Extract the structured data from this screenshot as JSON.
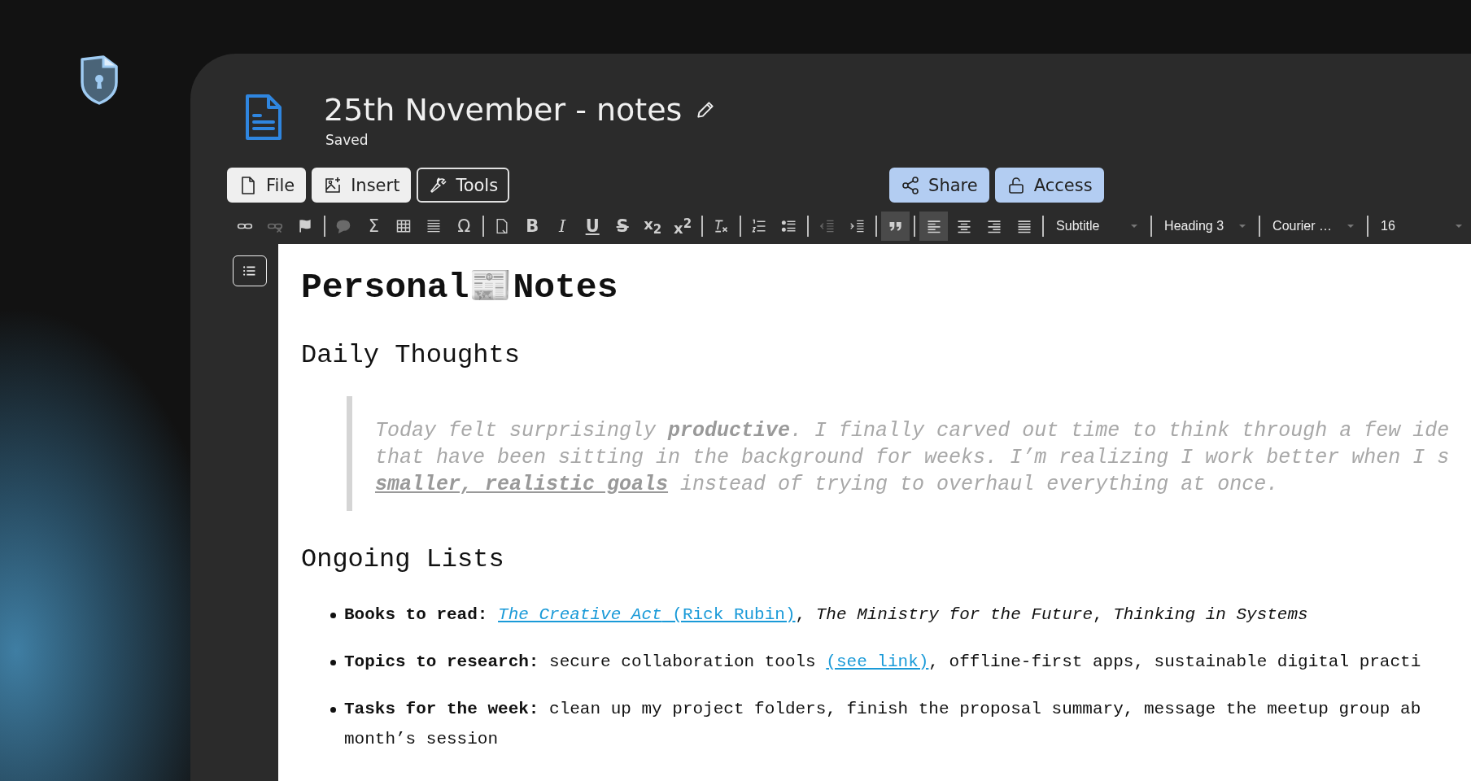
{
  "document": {
    "title": "25th November - notes",
    "status": "Saved"
  },
  "menu_buttons": [
    {
      "kind": "file",
      "label": "File",
      "selected": false
    },
    {
      "kind": "insert",
      "label": "Insert",
      "selected": false
    },
    {
      "kind": "tools",
      "label": "Tools",
      "selected": true
    }
  ],
  "share_buttons": [
    {
      "kind": "share",
      "label": "Share"
    },
    {
      "kind": "access",
      "label": "Access"
    }
  ],
  "toolbar": [
    {
      "kind": "link",
      "active": false,
      "disabled": false
    },
    {
      "kind": "unlink",
      "active": false,
      "disabled": true
    },
    {
      "kind": "flag",
      "active": false,
      "disabled": false
    },
    {
      "kind": "separator"
    },
    {
      "kind": "comment",
      "active": false,
      "disabled": true
    },
    {
      "kind": "char",
      "label": "Σ",
      "active": false,
      "disabled": false
    },
    {
      "kind": "table",
      "active": false,
      "disabled": false
    },
    {
      "kind": "rule",
      "active": false,
      "disabled": false
    },
    {
      "kind": "char",
      "label": "Ω",
      "active": false,
      "disabled": false
    },
    {
      "kind": "separator"
    },
    {
      "kind": "find",
      "active": false,
      "disabled": false
    },
    {
      "kind": "bold",
      "label": "B",
      "active": false,
      "disabled": false
    },
    {
      "kind": "italic",
      "label": "I",
      "active": false,
      "disabled": false
    },
    {
      "kind": "underline",
      "label": "U",
      "active": false,
      "disabled": false
    },
    {
      "kind": "strike",
      "label": "S",
      "active": false,
      "disabled": false
    },
    {
      "kind": "script",
      "label": "x$_{2}$",
      "active": false,
      "disabled": false
    },
    {
      "kind": "script",
      "label": "x$^{2}$",
      "active": false,
      "disabled": false
    },
    {
      "kind": "separator"
    },
    {
      "kind": "clear",
      "active": false,
      "disabled": false
    },
    {
      "kind": "separator"
    },
    {
      "kind": "ordered",
      "active": false,
      "disabled": false
    },
    {
      "kind": "bullets",
      "active": false,
      "disabled": false
    },
    {
      "kind": "separator"
    },
    {
      "kind": "outdent",
      "active": false,
      "disabled": true
    },
    {
      "kind": "indent",
      "active": false,
      "disabled": false
    },
    {
      "kind": "separator"
    },
    {
      "kind": "quote",
      "active": true,
      "disabled": false
    },
    {
      "kind": "separator"
    },
    {
      "kind": "align-left",
      "active": true,
      "disabled": false
    },
    {
      "kind": "align-center",
      "active": false,
      "disabled": false
    },
    {
      "kind": "align-right",
      "active": false,
      "disabled": false
    },
    {
      "kind": "justify",
      "active": false,
      "disabled": false
    },
    {
      "kind": "separator"
    },
    {
      "kind": "dropdown",
      "value": "Subtitle"
    },
    {
      "kind": "separator"
    },
    {
      "kind": "dropdown",
      "value": "Heading 3"
    },
    {
      "kind": "separator"
    },
    {
      "kind": "dropdown",
      "value": "Courier …"
    },
    {
      "kind": "separator"
    },
    {
      "kind": "dropdown",
      "value": "16"
    }
  ],
  "content": {
    "heading": "Personal📰Notes",
    "section_1": "Daily Thoughts",
    "quote_lines": [
      "Today felt surprisingly **productive**. I finally carved out time to think through a few ide",
      "that have been sitting in the background for weeks. I’m realizing I work better when I s"
    ],
    "quote_last": {
      "emphasis": "smaller, realistic goals",
      "rest": " instead of trying to overhaul everything at once."
    },
    "section_2": "Ongoing Lists",
    "list": [
      {
        "label": "Books to read:",
        "parts": [
          {
            "kind": "link",
            "text": "*The Creative Act* (Rick Rubin)"
          },
          {
            "kind": "text",
            "text": ", *The Ministry for the Future*, *Thinking in Systems*"
          }
        ]
      },
      {
        "label": "Topics to research:",
        "parts": [
          {
            "kind": "text",
            "text": "secure collaboration tools "
          },
          {
            "kind": "link",
            "text": "(see link)"
          },
          {
            "kind": "text",
            "text": ", offline-first apps, sustainable digital practi"
          }
        ]
      },
      {
        "label": "Tasks for the week:",
        "parts": [
          {
            "kind": "text",
            "text": "clean up my project folders, finish the proposal summary, message the meetup group ab"
          }
        ],
        "continuation": "month’s session"
      }
    ]
  }
}
